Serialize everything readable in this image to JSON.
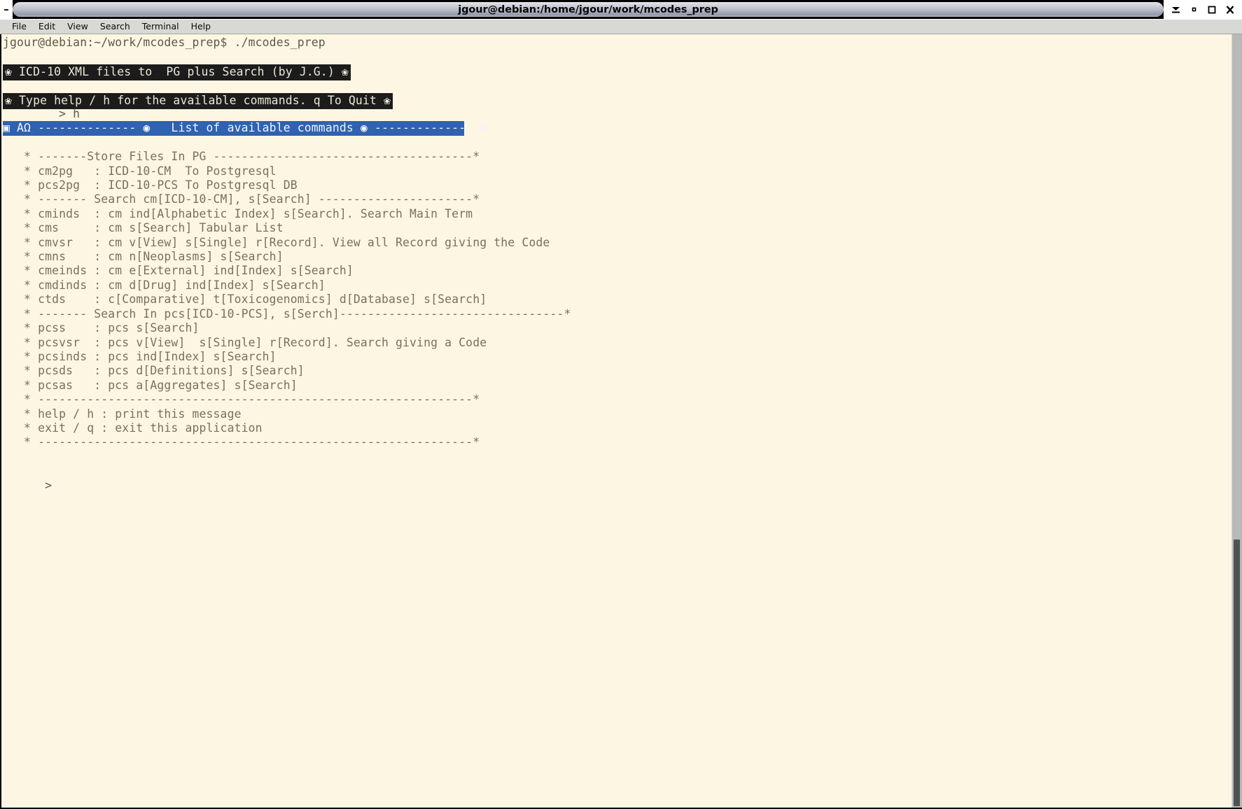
{
  "window": {
    "title": "jgour@debian:/home/jgour/work/mcodes_prep",
    "minimize_left_glyph": "–",
    "buttons": [
      {
        "name": "shade-button",
        "glyph": "shade"
      },
      {
        "name": "minimize-button",
        "glyph": "minimize"
      },
      {
        "name": "maximize-button",
        "glyph": "maximize"
      },
      {
        "name": "close-button",
        "glyph": "close"
      }
    ]
  },
  "menubar": {
    "items": [
      "File",
      "Edit",
      "View",
      "Search",
      "Terminal",
      "Help"
    ]
  },
  "terminal": {
    "shell_prompt_line": "jgour@debian:~/work/mcodes_prep$ ./mcodes_prep",
    "banner_title": "❀ ICD-10 XML files to  PG plus Search (by J.G.) ❀",
    "banner_hint": "❀ Type help / h for the available commands. q To Quit ❀",
    "user_input_line": "        > h",
    "highlight_bar": "▣ ΑΩ -------------- ◉   List of available commands ◉ -------------- ▣",
    "help_lines": [
      "   * -------Store Files In PG -------------------------------------*",
      "   * cm2pg   : ICD-10-CM  To Postgresql",
      "   * pcs2pg  : ICD-10-PCS To Postgresql DB",
      "   * ------- Search cm[ICD-10-CM], s[Search] ----------------------*",
      "   * cminds  : cm ind[Alphabetic Index] s[Search]. Search Main Term",
      "   * cms     : cm s[Search] Tabular List",
      "   * cmvsr   : cm v[View] s[Single] r[Record]. View all Record giving the Code",
      "   * cmns    : cm n[Neoplasms] s[Search]",
      "   * cmeinds : cm e[External] ind[Index] s[Search]",
      "   * cmdinds : cm d[Drug] ind[Index] s[Search]",
      "   * ctds    : c[Comparative] t[Toxicogenomics] d[Database] s[Search]",
      "   * ------- Search In pcs[ICD-10-PCS], s[Serch]--------------------------------*",
      "   * pcss    : pcs s[Search]",
      "   * pcsvsr  : pcs v[View]  s[Single] r[Record]. Search giving a Code",
      "   * pcsinds : pcs ind[Index] s[Search]",
      "   * pcsds   : pcs d[Definitions] s[Search]",
      "   * pcsas   : pcs a[Aggregates] s[Search]",
      "   * --------------------------------------------------------------*",
      "   * help / h : print this message",
      "   * exit / q : exit this application",
      "   * --------------------------------------------------------------*"
    ],
    "final_prompt": "      >"
  },
  "colors": {
    "terminal_bg": "#fdf6e3",
    "terminal_fg": "#7a7159",
    "banner_bg": "#1c1c1c",
    "banner_fg": "#ece7d6",
    "highlight_bg": "#2f62b0",
    "highlight_fg": "#f2f4f8",
    "menubar_bg": "#d8d8d4",
    "scrollbar_track": "#b9b9b9",
    "scrollbar_thumb": "#4d5350"
  }
}
